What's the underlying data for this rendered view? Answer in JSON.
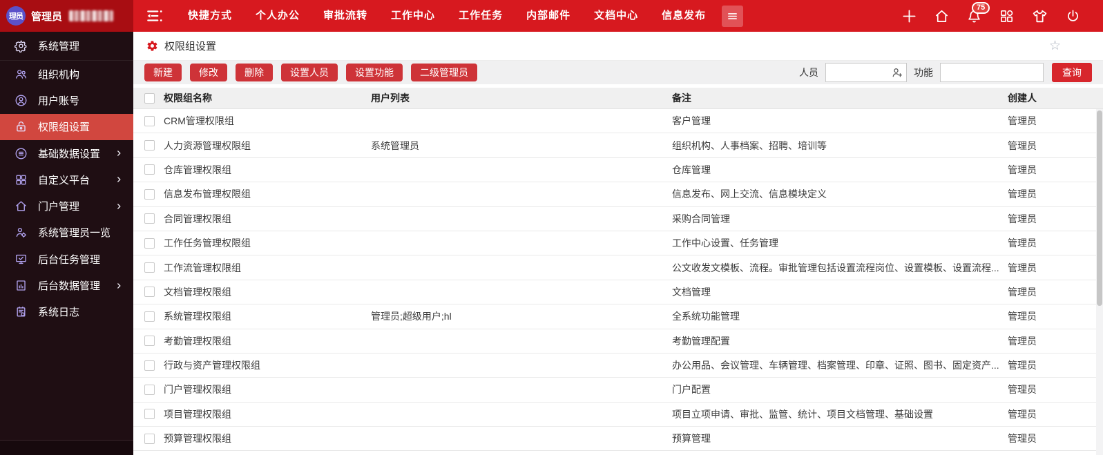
{
  "colors": {
    "accent": "#d7191f",
    "topbar_left": "#a80d12",
    "sidebar_bg": "#1f0e13",
    "active_item": "#d1473f",
    "button_red": "#ce3338",
    "search_red": "#d7262c",
    "avatar_bg": "#5b51c9",
    "icon_purple": "#b3a4f2"
  },
  "topbar": {
    "avatar_text": "理员",
    "user_label": "管理员",
    "nav_items": [
      "快捷方式",
      "个人办公",
      "审批流转",
      "工作中心",
      "工作任务",
      "内部邮件",
      "文档中心",
      "信息发布"
    ],
    "badge_count": "75"
  },
  "sidebar": {
    "items": [
      {
        "label": "系统管理",
        "icon": "gear",
        "header": true
      },
      {
        "label": "组织机构",
        "icon": "org"
      },
      {
        "label": "用户账号",
        "icon": "user"
      },
      {
        "label": "权限组设置",
        "icon": "lock",
        "active": true
      },
      {
        "label": "基础数据设置",
        "icon": "list",
        "expandable": true
      },
      {
        "label": "自定义平台",
        "icon": "grid",
        "expandable": true
      },
      {
        "label": "门户管理",
        "icon": "home",
        "expandable": true
      },
      {
        "label": "系统管理员一览",
        "icon": "admin"
      },
      {
        "label": "后台任务管理",
        "icon": "task"
      },
      {
        "label": "后台数据管理",
        "icon": "data",
        "expandable": true
      },
      {
        "label": "系统日志",
        "icon": "log"
      }
    ]
  },
  "page": {
    "title": "权限组设置"
  },
  "toolbar": {
    "buttons": [
      "新建",
      "修改",
      "删除",
      "设置人员",
      "设置功能",
      "二级管理员"
    ],
    "person_label": "人员",
    "function_label": "功能",
    "search_label": "查询"
  },
  "table": {
    "headers": [
      "权限组名称",
      "用户列表",
      "备注",
      "创建人"
    ],
    "rows": [
      {
        "name": "CRM管理权限组",
        "users": "",
        "remark": "客户管理",
        "creator": "管理员"
      },
      {
        "name": "人力资源管理权限组",
        "users": "系统管理员",
        "remark": "组织机构、人事档案、招聘、培训等",
        "creator": "管理员"
      },
      {
        "name": "仓库管理权限组",
        "users": "",
        "remark": "仓库管理",
        "creator": "管理员"
      },
      {
        "name": "信息发布管理权限组",
        "users": "",
        "remark": "信息发布、网上交流、信息模块定义",
        "creator": "管理员"
      },
      {
        "name": "合同管理权限组",
        "users": "",
        "remark": "采购合同管理",
        "creator": "管理员"
      },
      {
        "name": "工作任务管理权限组",
        "users": "",
        "remark": "工作中心设置、任务管理",
        "creator": "管理员"
      },
      {
        "name": "工作流管理权限组",
        "users": "",
        "remark": "公文收发文模板、流程。审批管理包括设置流程岗位、设置模板、设置流程...",
        "creator": "管理员"
      },
      {
        "name": "文档管理权限组",
        "users": "",
        "remark": "文档管理",
        "creator": "管理员"
      },
      {
        "name": "系统管理权限组",
        "users": "管理员;超级用户;hl",
        "remark": "全系统功能管理",
        "creator": "管理员"
      },
      {
        "name": "考勤管理权限组",
        "users": "",
        "remark": "考勤管理配置",
        "creator": "管理员"
      },
      {
        "name": "行政与资产管理权限组",
        "users": "",
        "remark": "办公用品、会议管理、车辆管理、档案管理、印章、证照、图书、固定资产...",
        "creator": "管理员"
      },
      {
        "name": "门户管理权限组",
        "users": "",
        "remark": "门户配置",
        "creator": "管理员"
      },
      {
        "name": "项目管理权限组",
        "users": "",
        "remark": "项目立项申请、审批、监管、统计、项目文档管理、基础设置",
        "creator": "管理员"
      },
      {
        "name": "预算管理权限组",
        "users": "",
        "remark": "预算管理",
        "creator": "管理员"
      }
    ]
  }
}
